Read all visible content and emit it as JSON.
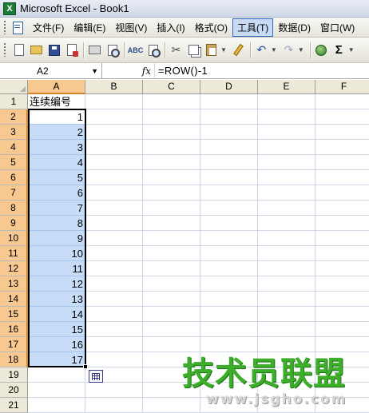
{
  "window": {
    "title": "Microsoft Excel - Book1",
    "app_icon_letter": "X"
  },
  "menu": {
    "items": [
      {
        "label": "文件(F)"
      },
      {
        "label": "编辑(E)"
      },
      {
        "label": "视图(V)"
      },
      {
        "label": "插入(I)"
      },
      {
        "label": "格式(O)"
      },
      {
        "label": "工具(T)",
        "active": true
      },
      {
        "label": "数据(D)"
      },
      {
        "label": "窗口(W)"
      }
    ]
  },
  "toolbar": {
    "buttons": [
      "new",
      "open",
      "save",
      "permission",
      "print",
      "print-preview",
      "spelling",
      "research",
      "cut",
      "copy",
      "paste",
      "format-painter",
      "undo",
      "redo",
      "hyperlink",
      "autosum"
    ],
    "sum_glyph": "Σ"
  },
  "formula_bar": {
    "name_box": "A2",
    "fx_label": "fx",
    "formula": "=ROW()-1"
  },
  "sheet": {
    "columns": [
      "A",
      "B",
      "C",
      "D",
      "E",
      "F"
    ],
    "selected_column": "A",
    "rows": [
      "1",
      "2",
      "3",
      "4",
      "5",
      "6",
      "7",
      "8",
      "9",
      "10",
      "11",
      "12",
      "13",
      "14",
      "15",
      "16",
      "17",
      "18",
      "19",
      "20",
      "21"
    ],
    "selected_rows": [
      "2",
      "3",
      "4",
      "5",
      "6",
      "7",
      "8",
      "9",
      "10",
      "11",
      "12",
      "13",
      "14",
      "15",
      "16",
      "17",
      "18"
    ],
    "a1": "连续编号",
    "a_values": [
      "1",
      "2",
      "3",
      "4",
      "5",
      "6",
      "7",
      "8",
      "9",
      "10",
      "11",
      "12",
      "13",
      "14",
      "15",
      "16",
      "17"
    ]
  },
  "watermark": {
    "main": "技术员联盟",
    "url": "www.jsgho.com"
  },
  "colors": {
    "selection": "#c7dcf6",
    "header_selected": "#f7c88f",
    "watermark": "#3cae2a"
  }
}
